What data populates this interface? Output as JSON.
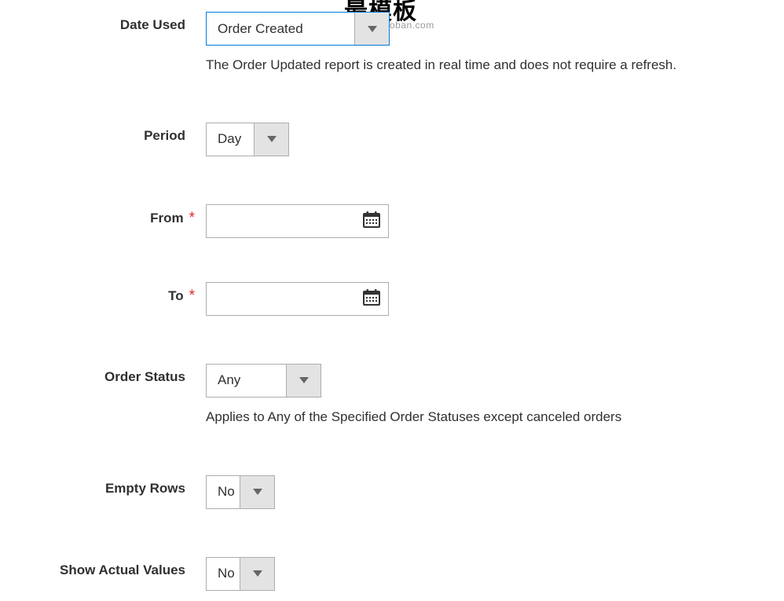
{
  "form": {
    "date_used": {
      "label": "Date Used",
      "value": "Order Created",
      "help": "The Order Updated report is created in real time and does not require a refresh."
    },
    "period": {
      "label": "Period",
      "value": "Day"
    },
    "from": {
      "label": "From",
      "value": ""
    },
    "to": {
      "label": "To",
      "value": ""
    },
    "order_status": {
      "label": "Order Status",
      "value": "Any",
      "help": "Applies to Any of the Specified Order Statuses except canceled orders"
    },
    "empty_rows": {
      "label": "Empty Rows",
      "value": "No"
    },
    "show_actual_values": {
      "label": "Show Actual Values",
      "value": "No"
    }
  },
  "watermark": {
    "title": "最模板",
    "url": "www.zuimoban.com"
  }
}
